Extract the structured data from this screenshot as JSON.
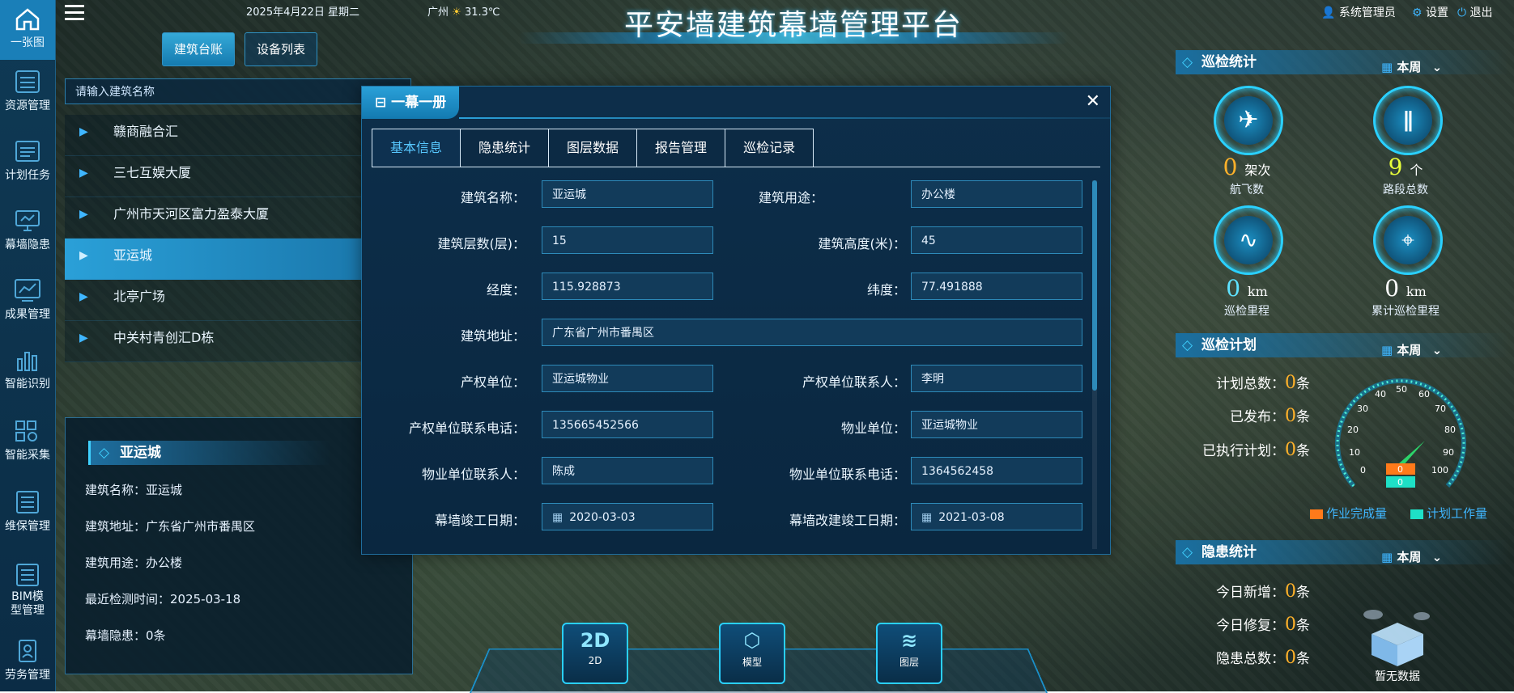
{
  "header": {
    "title": "平安墙建筑幕墙管理平台",
    "date": "2025年4月22日 星期二",
    "weather_city": "广州",
    "weather_temp": "31.3℃",
    "user": "系统管理员",
    "settings": "设置",
    "logout": "退出"
  },
  "sidebar": {
    "items": [
      {
        "label": "一张图",
        "icon": "home-icon"
      },
      {
        "label": "资源管理",
        "icon": "list-icon"
      },
      {
        "label": "计划任务",
        "icon": "calendar-list-icon"
      },
      {
        "label": "幕墙隐患",
        "icon": "monitor-icon"
      },
      {
        "label": "成果管理",
        "icon": "chart-line-icon"
      },
      {
        "label": "智能识别",
        "icon": "bar-chart-icon"
      },
      {
        "label": "智能采集",
        "icon": "gear-grid-icon"
      },
      {
        "label": "维保管理",
        "icon": "doc-list-icon"
      },
      {
        "label": "BIM模型管理",
        "icon": "bim-doc-icon"
      },
      {
        "label": "劳务管理",
        "icon": "id-card-icon"
      }
    ]
  },
  "left_tabs": {
    "account": "建筑台账",
    "devices": "设备列表"
  },
  "search": {
    "placeholder": "请输入建筑名称"
  },
  "buildings": [
    "赣商融合汇",
    "三七互娱大厦",
    "广州市天河区富力盈泰大厦",
    "亚运城",
    "北亭广场",
    "中关村青创汇D栋"
  ],
  "selected_building": {
    "title": "亚运城",
    "rows": [
      "建筑名称：亚运城",
      "建筑地址：广东省广州市番禺区",
      "建筑用途：办公楼",
      "最近检测时间：2025-03-18",
      "幕墙隐患：0条"
    ]
  },
  "modal": {
    "title": "一幕一册",
    "close": "✕",
    "tabs": [
      "基本信息",
      "隐患统计",
      "图层数据",
      "报告管理",
      "巡检记录"
    ],
    "fields": {
      "name_label": "建筑名称：",
      "name": "亚运城",
      "use_label": "建筑用途：",
      "use": "办公楼",
      "floors_label": "建筑层数(层)：",
      "floors": "15",
      "height_label": "建筑高度(米)：",
      "height": "45",
      "lng_label": "经度：",
      "lng": "115.928873",
      "lat_label": "纬度：",
      "lat": "77.491888",
      "addr_label": "建筑地址：",
      "addr": "广东省广州市番禺区",
      "owner_label": "产权单位：",
      "owner": "亚运城物业",
      "owner_contact_label": "产权单位联系人：",
      "owner_contact": "李明",
      "owner_phone_label": "产权单位联系电话：",
      "owner_phone": "135665452566",
      "prop_label": "物业单位：",
      "prop": "亚运城物业",
      "prop_contact_label": "物业单位联系人：",
      "prop_contact": "陈成",
      "prop_phone_label": "物业单位联系电话：",
      "prop_phone": "1364562458",
      "completed_label": "幕墙竣工日期：",
      "completed": "2020-03-03",
      "renovated_label": "幕墙改建竣工日期：",
      "renovated": "2021-03-08"
    }
  },
  "inspection_stats": {
    "title": "巡检统计",
    "period": "本周",
    "flights": {
      "value": "0",
      "unit": "架次",
      "label": "航飞数"
    },
    "segments": {
      "value": "9",
      "unit": "个",
      "label": "路段总数"
    },
    "mileage": {
      "value": "0",
      "unit": "km",
      "label": "巡检里程"
    },
    "total_mileage": {
      "value": "0",
      "unit": "km",
      "label": "累计巡检里程"
    }
  },
  "inspection_plan": {
    "title": "巡检计划",
    "period": "本周",
    "total_label": "计划总数：",
    "total": "0",
    "total_unit": "条",
    "published_label": "已发布：",
    "published": "0",
    "published_unit": "条",
    "executed_label": "已执行计划：",
    "executed": "0",
    "executed_unit": "条",
    "gauge_ticks": [
      "0",
      "10",
      "20",
      "30",
      "40",
      "50",
      "60",
      "70",
      "80",
      "90",
      "100"
    ],
    "gauge_values": [
      "0",
      "0"
    ],
    "legend_done": "作业完成量",
    "legend_plan": "计划工作量"
  },
  "hazard_stats": {
    "title": "隐患统计",
    "period": "本周",
    "today_new_label": "今日新增：",
    "today_new": "0",
    "today_new_unit": "条",
    "today_fixed_label": "今日修复：",
    "today_fixed": "0",
    "today_fixed_unit": "条",
    "total_label": "隐患总数：",
    "total": "0",
    "total_unit": "条",
    "empty": "暂无数据"
  },
  "bottom": {
    "b2d": "2D",
    "b2d_label": "2D",
    "model": "模型",
    "layers": "图层"
  },
  "colors": {
    "accent": "#2aa0d8",
    "warn": "#ffb12a",
    "cyan": "#2ad0ff"
  }
}
